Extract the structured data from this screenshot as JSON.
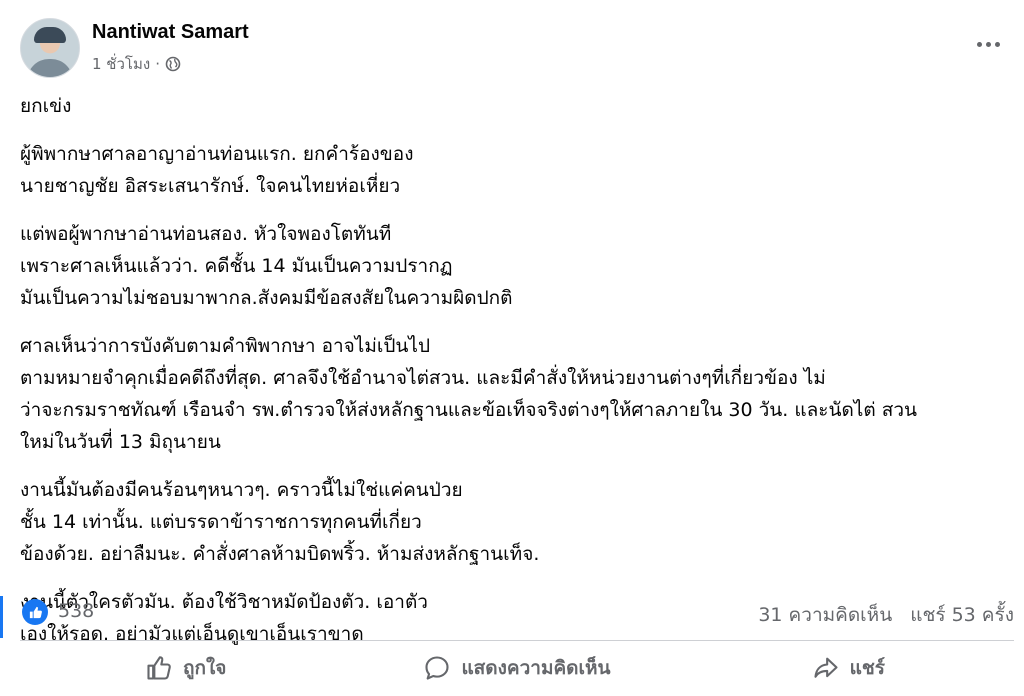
{
  "post": {
    "author": "Nantiwat Samart",
    "time": "1 ชั่วโมง",
    "separator": "·",
    "paragraphs": [
      [
        "ยกเข่ง"
      ],
      [
        "ผู้พิพากษาศาลอาญาอ่านท่อนแรก. ยกคำร้องของ",
        "นายชาญชัย อิสระเสนารักษ์. ใจคนไทยห่อเหี่ยว"
      ],
      [
        "แต่พอผู้พากษาอ่านท่อนสอง. หัวใจพองโตทันที",
        "เพราะศาลเห็นแล้วว่า. คดีชั้น 14 มันเป็นความปรากฏ",
        "มันเป็นความไม่ชอบมาพากล.สังคมมีข้อสงสัยในความผิดปกติ"
      ],
      [
        "ศาลเห็นว่าการบังคับตามคำพิพากษา อาจไม่เป็นไป",
        "ตามหมายจำคุกเมื่อคดีถึงที่สุด. ศาลจึงใช้อำนาจไต่สวน. และมีคำสั่งให้หน่วยงานต่างๆที่เกี่ยวข้อง ไม่",
        "ว่าจะกรมราชทัณฑ์ เรือนจำ รพ.ตำรวจให้ส่งหลักฐานและข้อเท็จจริงต่างๆให้ศาลภายใน 30 วัน. และนัดไต่ สวน",
        "ใหม่ในวันที่ 13 มิถุนายน"
      ],
      [
        "งานนี้มันต้องมีคนร้อนๆหนาวๆ. คราวนี้ไม่ใช่แค่คนป่วย",
        "ชั้น 14 เท่านั้น. แต่บรรดาข้าราชการทุกคนที่เกี่ยว",
        "ข้องด้วย.  อย่าลืมนะ. คำสั่งศาลห้ามบิดพริ้ว. ห้ามส่งหลักฐานเท็จ."
      ],
      [
        "งานนี้ตัวใครตัวมัน. ต้องใช้วิชาหมัดป้องตัว. เอาตัว",
        "เองให้รอด. อย่ามัวแต่เอ็นดูเขาเอ็นเราขาด"
      ]
    ]
  },
  "stats": {
    "likes": "538",
    "comments": "31 ความคิดเห็น",
    "shares": "แชร์ 53 ครั้ง"
  },
  "actions": {
    "like": "ถูกใจ",
    "comment": "แสดงความคิดเห็น",
    "share": "แชร์"
  },
  "icons": {
    "audience": "globe-icon",
    "more": "more-options-icon",
    "reaction": "thumbs-up-icon",
    "like": "like-icon",
    "comment": "comment-icon",
    "share": "share-icon"
  },
  "colors": {
    "accent": "#1877f2",
    "secondary_text": "#65676b",
    "divider": "#ced0d4"
  }
}
